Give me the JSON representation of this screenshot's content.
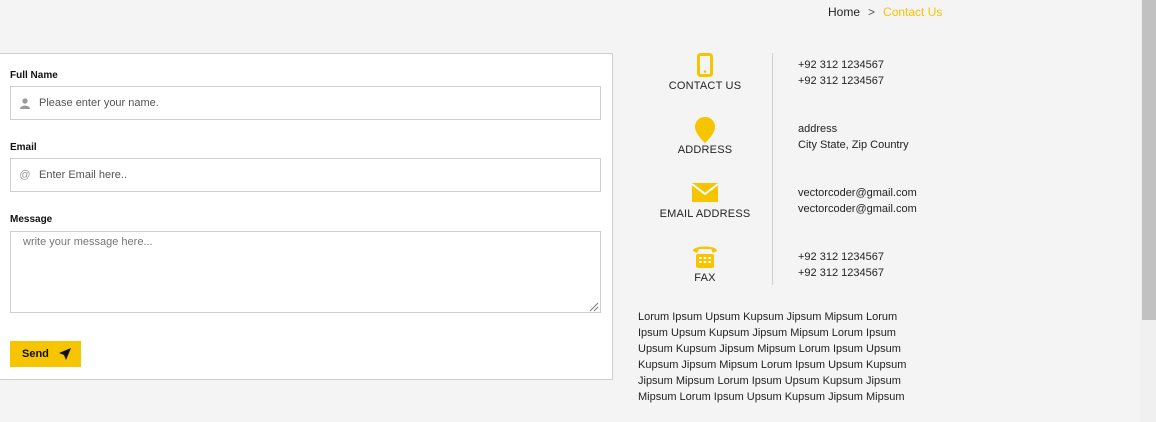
{
  "breadcrumb": {
    "home": "Home",
    "separator": ">",
    "current": "Contact Us"
  },
  "form": {
    "full_name": {
      "label": "Full Name",
      "placeholder": "Please enter your name.",
      "icon": "user-icon"
    },
    "email": {
      "label": "Email",
      "placeholder": "Enter Email here..",
      "icon": "at-icon"
    },
    "message": {
      "label": "Message",
      "placeholder": "write your message here..."
    },
    "send_label": "Send",
    "send_icon": "paper-plane-icon"
  },
  "contact_info": {
    "accent_color": "#f7c400",
    "items": [
      {
        "title": "CONTACT US",
        "icon": "mobile-phone-icon",
        "line1": "+92 312 1234567",
        "line2": "+92 312 1234567"
      },
      {
        "title": "ADDRESS",
        "icon": "map-pin-icon",
        "line1": "address",
        "line2": "City State, Zip Country"
      },
      {
        "title": "EMAIL ADDRESS",
        "icon": "envelope-icon",
        "line1": "vectorcoder@gmail.com",
        "line2": "vectorcoder@gmail.com"
      },
      {
        "title": "FAX",
        "icon": "fax-phone-icon",
        "line1": "+92 312 1234567",
        "line2": "+92 312 1234567"
      }
    ]
  },
  "about_text": "Lorum Ipsum Upsum Kupsum Jipsum Mipsum Lorum Ipsum Upsum Kupsum Jipsum Mipsum Lorum Ipsum Upsum Kupsum Jipsum Mipsum Lorum Ipsum Upsum Kupsum Jipsum Mipsum Lorum Ipsum Upsum Kupsum Jipsum Mipsum Lorum Ipsum Upsum Kupsum Jipsum Mipsum Lorum Ipsum Upsum Kupsum Jipsum Mipsum"
}
